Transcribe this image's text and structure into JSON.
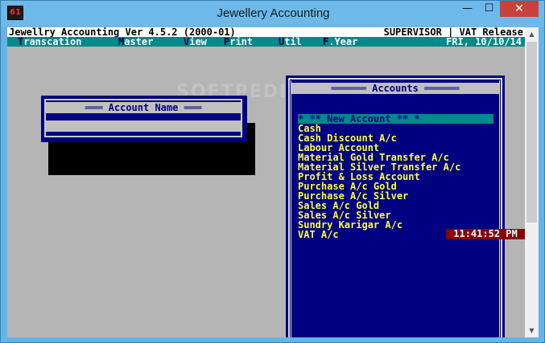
{
  "window": {
    "title": "Jewellery Accounting",
    "icon_label": "61",
    "controls": {
      "minimize": "—",
      "maximize": "☐",
      "close": "✕"
    }
  },
  "console": {
    "header_left": "Jewellry Accounting Ver 4.5.2 (2000-01)",
    "header_right": "SUPERVISOR | VAT Release",
    "menu": [
      {
        "hotkey": "T",
        "rest": "ranscation"
      },
      {
        "hotkey": "M",
        "rest": "aster"
      },
      {
        "hotkey": "V",
        "rest": "iew"
      },
      {
        "hotkey": "P",
        "rest": "rint"
      },
      {
        "hotkey": "U",
        "rest": "til"
      },
      {
        "hotkey": "F",
        "rest": ".Year"
      }
    ],
    "date": "FRI, 10/10/14",
    "watermark": "SOFTPEDIA"
  },
  "account_name_dialog": {
    "title": "═══ Account Name ═══",
    "value": ""
  },
  "accounts_panel": {
    "title": "══════ Accounts ══════",
    "items": [
      "* ** New Account ** *",
      "Cash",
      "Cash Discount A/c",
      "Labour Account",
      "Material Gold Transfer A/c",
      "Material Silver Transfer A/c",
      "Profit & Loss Account",
      "Purchase A/c Gold",
      "Purchase A/c Silver",
      "Sales A/c Gold",
      "Sales A/c Silver",
      "Sundry Karigar A/c",
      "VAT A/c"
    ],
    "selected_index": 0
  },
  "clock": "11:41:52 PM",
  "colors": {
    "menu_bg": "#008a8a",
    "panel_bg": "#000080",
    "item_text": "#ffff3a",
    "desktop": "#b5b5b5",
    "clock_bg": "#8b0000"
  }
}
